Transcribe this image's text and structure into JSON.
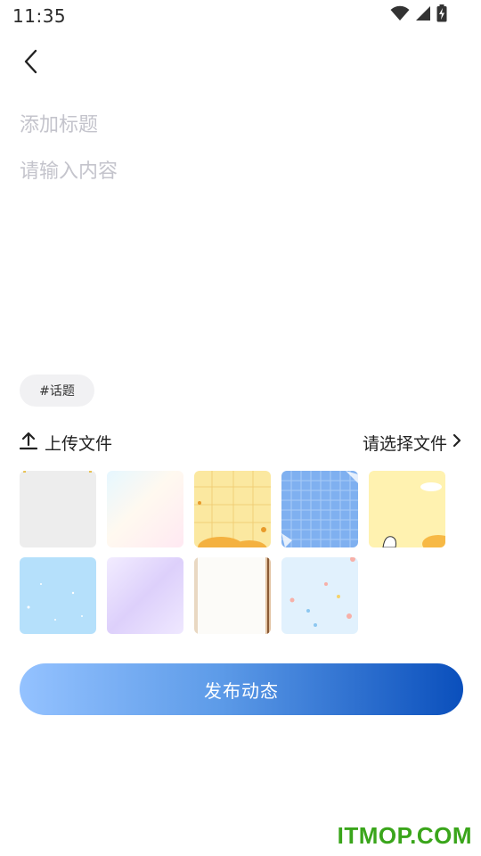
{
  "status_bar": {
    "time": "11:35",
    "icons": [
      "wifi-icon",
      "signal-icon",
      "battery-charging-icon"
    ]
  },
  "header": {
    "back_icon": "chevron-left-icon"
  },
  "editor": {
    "title_placeholder": "添加标题",
    "title_value": "",
    "content_placeholder": "请输入内容",
    "content_value": ""
  },
  "topic_chip": {
    "label": "#话题"
  },
  "upload": {
    "label": "上传文件",
    "icon": "upload-icon",
    "choose_label": "请选择文件",
    "choose_icon": "chevron-right-icon"
  },
  "backgrounds": {
    "items": [
      "gray-texture",
      "pastel-gradient",
      "yellow-grid",
      "blue-grid",
      "yellow-cloud",
      "light-blue-dots",
      "lavender-gradient",
      "paper-scroll",
      "pale-blue-confetti"
    ]
  },
  "publish": {
    "label": "发布动态"
  },
  "watermark": {
    "text": "ITMOP.COM"
  },
  "colors": {
    "placeholder": "#c4c4cc",
    "button_gradient_start": "#94c2ff",
    "button_gradient_end": "#0a4fbc",
    "watermark": "#3aa51b"
  }
}
